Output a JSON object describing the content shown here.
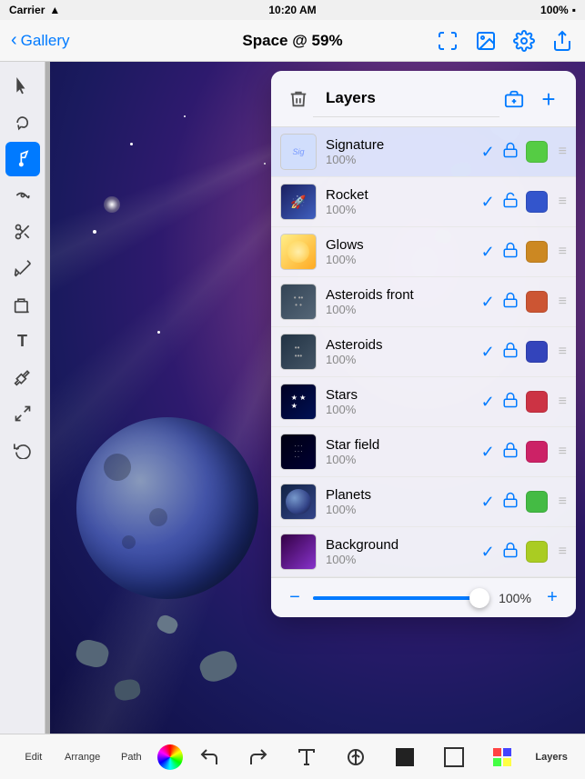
{
  "statusBar": {
    "carrier": "Carrier",
    "time": "10:20 AM",
    "battery": "100%"
  },
  "navBar": {
    "backLabel": "Gallery",
    "title": "Space @ 59%"
  },
  "tools": [
    {
      "name": "select",
      "icon": "↖",
      "label": "Select Tool"
    },
    {
      "name": "lasso",
      "icon": "⚡",
      "label": "Lasso Tool"
    },
    {
      "name": "brush",
      "icon": "✏",
      "label": "Brush Tool",
      "active": true
    },
    {
      "name": "smudge",
      "icon": "✦",
      "label": "Smudge Tool"
    },
    {
      "name": "scissors",
      "icon": "✂",
      "label": "Scissors Tool"
    },
    {
      "name": "pen",
      "icon": "∕",
      "label": "Pen Tool"
    },
    {
      "name": "eraser",
      "icon": "◻",
      "label": "Eraser Tool"
    },
    {
      "name": "text",
      "icon": "T",
      "label": "Text Tool"
    },
    {
      "name": "eyedrop",
      "icon": "⊘",
      "label": "Eyedropper"
    },
    {
      "name": "transform",
      "icon": "⊞",
      "label": "Transform"
    },
    {
      "name": "undo-rotate",
      "icon": "↺",
      "label": "Undo"
    }
  ],
  "layersPanel": {
    "title": "Layers",
    "deleteLabel": "🗑",
    "addGroupLabel": "⊞",
    "addLayerLabel": "+",
    "layers": [
      {
        "name": "Signature",
        "opacity": "100%",
        "visible": true,
        "locked": true,
        "color": "#55cc44",
        "thumbClass": "thumb-signature",
        "active": true
      },
      {
        "name": "Rocket",
        "opacity": "100%",
        "visible": true,
        "locked": false,
        "color": "#3355cc",
        "thumbClass": "thumb-rocket"
      },
      {
        "name": "Glows",
        "opacity": "100%",
        "visible": true,
        "locked": true,
        "color": "#cc8822",
        "thumbClass": "thumb-glows"
      },
      {
        "name": "Asteroids front",
        "opacity": "100%",
        "visible": true,
        "locked": true,
        "color": "#cc5533",
        "thumbClass": "thumb-asteroids-front"
      },
      {
        "name": "Asteroids",
        "opacity": "100%",
        "visible": true,
        "locked": true,
        "color": "#3344bb",
        "thumbClass": "thumb-asteroids"
      },
      {
        "name": "Stars",
        "opacity": "100%",
        "visible": true,
        "locked": true,
        "color": "#cc3344",
        "thumbClass": "thumb-stars"
      },
      {
        "name": "Star field",
        "opacity": "100%",
        "visible": true,
        "locked": true,
        "color": "#cc2266",
        "thumbClass": "thumb-starfield"
      },
      {
        "name": "Planets",
        "opacity": "100%",
        "visible": true,
        "locked": true,
        "color": "#44bb44",
        "thumbClass": "thumb-planets"
      },
      {
        "name": "Background",
        "opacity": "100%",
        "visible": true,
        "locked": true,
        "color": "#aacc22",
        "thumbClass": "thumb-background"
      }
    ],
    "slider": {
      "value": "100%",
      "min": "−",
      "plus": "+"
    }
  },
  "bottomBar": {
    "items": [
      {
        "label": "Edit",
        "type": "text"
      },
      {
        "label": "Arrange",
        "type": "text"
      },
      {
        "label": "Path",
        "type": "text"
      },
      {
        "label": "color-wheel",
        "type": "color"
      },
      {
        "label": "undo",
        "type": "icon"
      },
      {
        "label": "redo",
        "type": "icon"
      },
      {
        "label": "text-tool",
        "type": "icon"
      },
      {
        "label": "adjust",
        "type": "icon"
      },
      {
        "label": "rect",
        "type": "icon"
      },
      {
        "label": "square-outline",
        "type": "icon"
      },
      {
        "label": "mosaic",
        "type": "icon"
      },
      {
        "label": "Layers",
        "type": "text"
      }
    ]
  }
}
